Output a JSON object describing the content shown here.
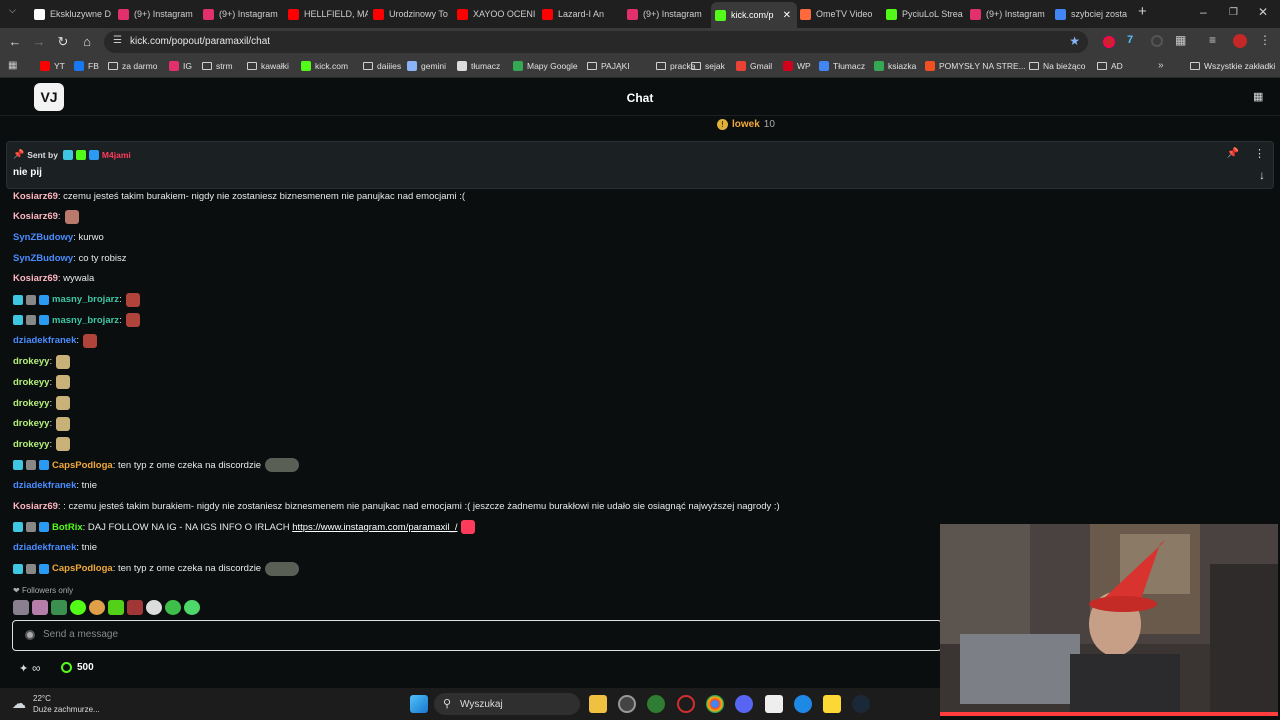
{
  "browser": {
    "tabs": [
      {
        "label": "Ekskluzywne D",
        "color": "#ffffff"
      },
      {
        "label": "(9+) Instagram",
        "color": "#e1306c"
      },
      {
        "label": "(9+) Instagram",
        "color": "#e1306c"
      },
      {
        "label": "HELLFIELD, MA",
        "color": "#ff0000"
      },
      {
        "label": "Urodzinowy To",
        "color": "#ff0000"
      },
      {
        "label": "XAYOO OCENI",
        "color": "#ff0000"
      },
      {
        "label": "Lazard-I An",
        "color": "#ff0000"
      },
      {
        "label": "(9+) Instagram",
        "color": "#e1306c"
      },
      {
        "label": "kick.com/p",
        "color": "#53fc18"
      },
      {
        "label": "OmeTV Video",
        "color": "#ff6a3d"
      },
      {
        "label": "PyciuLoL Strea",
        "color": "#53fc18"
      },
      {
        "label": "(9+) Instagram",
        "color": "#e1306c"
      },
      {
        "label": "szybciej zosta",
        "color": "#4285f4"
      }
    ],
    "new_tab_glyph": "+",
    "url": "kick.com/popout/paramaxil/chat",
    "bookmarks": [
      {
        "label": "YT",
        "icon": "youtube",
        "color": "#ff0000"
      },
      {
        "label": "FB",
        "icon": "facebook",
        "color": "#1877f2"
      },
      {
        "label": "za darmo",
        "icon": "folder",
        "color": ""
      },
      {
        "label": "IG",
        "icon": "instagram",
        "color": "#e1306c"
      },
      {
        "label": "strm",
        "icon": "folder",
        "color": ""
      },
      {
        "label": "kawałki",
        "icon": "folder",
        "color": ""
      },
      {
        "label": "kick.com",
        "icon": "kick",
        "color": "#53fc18"
      },
      {
        "label": "daiiies",
        "icon": "folder",
        "color": ""
      },
      {
        "label": "gemini",
        "icon": "gemini",
        "color": "#8ab4f8"
      },
      {
        "label": "tłumacz",
        "icon": "translate",
        "color": "#dddddd"
      },
      {
        "label": "Mapy Google",
        "icon": "maps",
        "color": "#34a853"
      },
      {
        "label": "PAJĄKI",
        "icon": "folder",
        "color": ""
      },
      {
        "label": "pracka",
        "icon": "folder",
        "color": ""
      },
      {
        "label": "sejak",
        "icon": "folder",
        "color": ""
      },
      {
        "label": "Gmail",
        "icon": "gmail",
        "color": "#ea4335"
      },
      {
        "label": "WP",
        "icon": "wp",
        "color": "#d0021b"
      },
      {
        "label": "Tłumacz",
        "icon": "translate",
        "color": "#4285f4"
      },
      {
        "label": "ksiazka",
        "icon": "book",
        "color": "#34a853"
      },
      {
        "label": "POMYSŁY NA STRE...",
        "icon": "microsoft",
        "color": "#f25022"
      },
      {
        "label": "Na bieżąco",
        "icon": "folder",
        "color": ""
      },
      {
        "label": "AD",
        "icon": "folder",
        "color": ""
      }
    ],
    "all_bookmarks": "Wszystkie zakładki"
  },
  "kick": {
    "title": "Chat",
    "logo_text": "VJ",
    "gift_user": "lowek",
    "gift_count": "10",
    "pinned": {
      "sent_by_label": "Sent by",
      "user": "M4jami",
      "message": "nie pij"
    },
    "messages": [
      {
        "user": "Kosiarz69",
        "color": "#ffb6c1",
        "text": "czemu jesteś takim burakiem- nigdy nie zostaniesz biznesmenem nie panujkac nad emocjami :(",
        "sep": ": "
      },
      {
        "user": "Kosiarz69",
        "color": "#ffb6c1",
        "text": "",
        "sep": ":"
      },
      {
        "user": "SynZBudowy",
        "color": "#4a8cff",
        "text": "kurwo",
        "sep": ": "
      },
      {
        "user": "SynZBudowy",
        "color": "#4a8cff",
        "text": "co ty robisz",
        "sep": ": "
      },
      {
        "user": "Kosiarz69",
        "color": "#ffb6c1",
        "text": "wywala",
        "sep": ": "
      },
      {
        "user": "masny_brojarz",
        "color": "#3fc6a6",
        "text": "",
        "sep": ":"
      },
      {
        "user": "masny_brojarz",
        "color": "#3fc6a6",
        "text": "",
        "sep": ":"
      },
      {
        "user": "dziadekfranek",
        "color": "#4a8cff",
        "text": "",
        "sep": ":"
      },
      {
        "user": "drokeyy",
        "color": "#b5f07a",
        "text": "",
        "sep": ":"
      },
      {
        "user": "drokeyy",
        "color": "#b5f07a",
        "text": "",
        "sep": ":"
      },
      {
        "user": "drokeyy",
        "color": "#b5f07a",
        "text": "",
        "sep": ":"
      },
      {
        "user": "drokeyy",
        "color": "#b5f07a",
        "text": "",
        "sep": ":"
      },
      {
        "user": "drokeyy",
        "color": "#b5f07a",
        "text": "",
        "sep": ":"
      },
      {
        "user": "CapsPodloga",
        "color": "#f0a93a",
        "text": "ten typ z ome czeka na discordzie",
        "sep": ": "
      },
      {
        "user": "dziadekfranek",
        "color": "#4a8cff",
        "text": "tnie",
        "sep": ": "
      },
      {
        "user": "Kosiarz69",
        "color": "#ffb6c1",
        "text": ": czemu jesteś takim burakiem- nigdy nie zostaniesz biznesmenem nie panujkac nad emocjami :( jeszcze żadnemu burakłowi nie udało sie osiagnąć najwyższej nagrody :)",
        "sep": ": "
      },
      {
        "user": "BotRix",
        "color": "#53fc18",
        "text": "DAJ FOLLOW NA IG - NA IGS INFO O IRLACH",
        "link": "https://www.instagram.com/paramaxil_/",
        "sep": ": "
      },
      {
        "user": "dziadekfranek",
        "color": "#4a8cff",
        "text": "tnie",
        "sep": ": "
      },
      {
        "user": "CapsPodloga",
        "color": "#f0a93a",
        "text": "ten typ z ome czeka na discordzie",
        "sep": ": "
      }
    ],
    "followers_only": "Followers only",
    "input_placeholder": "Send a message",
    "points": "500"
  },
  "taskbar": {
    "weather_temp": "22°C",
    "weather_desc": "Duże zachmurze...",
    "search_label": "Wyszukaj"
  }
}
